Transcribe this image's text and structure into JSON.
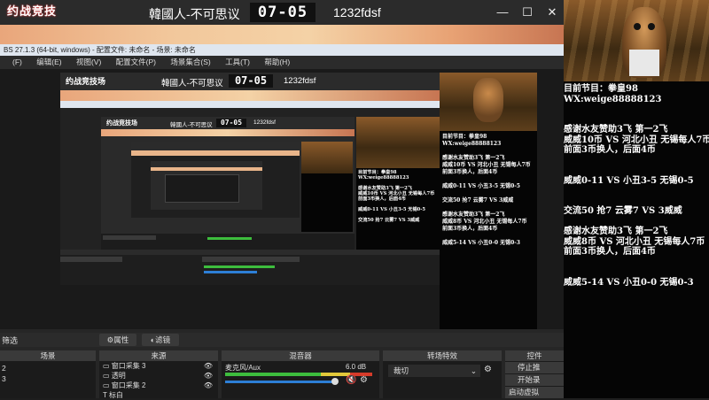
{
  "stream": {
    "logo_text": "约战竞技场",
    "title": "韓國人-不可思议",
    "timer": "07-05",
    "room": "1232fdsf",
    "window_buttons": [
      "—",
      "☐",
      "✕"
    ]
  },
  "obs": {
    "title_text": "BS 27.1.3 (64-bit, windows) - 配置文件: 未命名 - 场景: 未命名",
    "menu": [
      "(F)",
      "编辑(E)",
      "视图(V)",
      "配置文件(P)",
      "场景集合(S)",
      "工具(T)",
      "帮助(H)"
    ],
    "preview_title": "韓國人-不可思议",
    "preview_timer": "07-05",
    "preview_room": "1232fdsf"
  },
  "docks": {
    "scenes_label": "场景",
    "scenes_items": [
      "2",
      "3"
    ],
    "filter_label": "筛选",
    "properties_label": "属性",
    "filters_label": "滤镜",
    "sources_label": "来源",
    "sources_items": [
      "窗口采集 3",
      "透明",
      "窗口采集 2",
      "标白"
    ],
    "mixer_label": "混音器",
    "mixer_channel": "麦克风/Aux",
    "mixer_db": "6.0 dB",
    "transitions_label": "转场特效",
    "transition_value": "裁切",
    "controls_label": "控件",
    "controls": [
      "停止推",
      "开始录",
      "启动虚拟"
    ]
  },
  "panel": {
    "lines": [
      "目前节目：拳皇98",
      "WX:weige88888123",
      "",
      "",
      "感谢水友赞助3飞 第一2飞",
      "威威10币 VS 河北小丑 无锡每人7币",
      "前面3币换人，后面4币",
      "",
      "威威0-11 VS 小丑3-5 无锡0-5",
      "",
      "交流50 抢7 云雾7 VS 3威威",
      "",
      "感谢水友赞助3飞 第一2飞",
      "威威8币 VS 河北小丑 无锡每人7币",
      "前面3币换人，后面4币",
      "",
      "威威5-14 VS 小丑0-0 无锡0-3"
    ]
  },
  "colors": {
    "accent_red": "#d63b2a",
    "banner": "#f2c79b",
    "meter_green": "#3dbd3d"
  }
}
